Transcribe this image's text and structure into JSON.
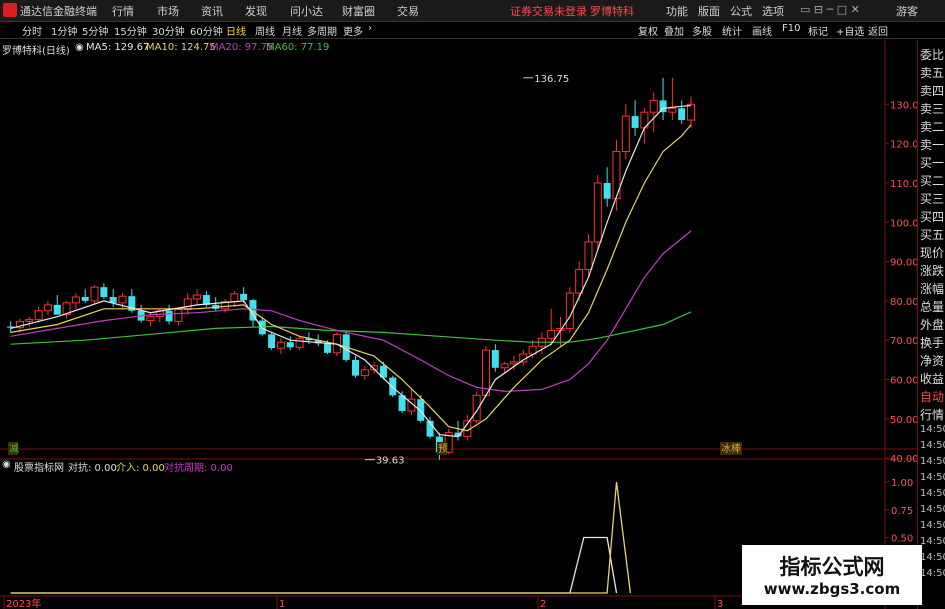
{
  "app": {
    "title": "通达信金融终端",
    "menu": [
      "行情",
      "市场",
      "资讯",
      "发现",
      "问小达",
      "财富圈",
      "交易"
    ],
    "notice": "证券交易未登录",
    "stock_name": "罗博特科",
    "right_menu": [
      "功能",
      "版面",
      "公式",
      "选项"
    ],
    "guest": "游客"
  },
  "periods": [
    "分时",
    "1分钟",
    "5分钟",
    "15分钟",
    "30分钟",
    "60分钟",
    "日线",
    "周线",
    "月线",
    "多周期",
    "更多"
  ],
  "active_period": "日线",
  "tools": [
    "复权",
    "叠加",
    "多股",
    "统计",
    "画线",
    "F10",
    "标记",
    "+自选",
    "返回"
  ],
  "header": {
    "stock": "罗博特科",
    "period": "(日线)",
    "ma": [
      {
        "label": "MA5: 129.67",
        "color": "#e8e8e8"
      },
      {
        "label": "MA10: 124.75",
        "color": "#e6d468"
      },
      {
        "label": "MA20: 97.75",
        "color": "#c040c0"
      },
      {
        "label": "MA60: 77.19",
        "color": "#40c040"
      }
    ]
  },
  "right_panel": [
    "委比",
    "卖五",
    "卖四",
    "卖三",
    "卖二",
    "卖一",
    "买一",
    "买二",
    "买三",
    "买四",
    "买五",
    "现价",
    "涨跌",
    "涨幅",
    "总量",
    "外盘",
    "换手",
    "净资",
    "收益",
    "自动",
    "行情",
    "14:50",
    "14:50",
    "14:50",
    "14:50",
    "14:50",
    "14:50",
    "14:50",
    "14:50",
    "14:50",
    "14:50"
  ],
  "indicator": {
    "name": "股票指标网",
    "duikang": "对抗: 0.00",
    "jieru": "介入: 0.00",
    "zhouqi": "对抗周期: 0.00",
    "yticks": [
      "1.00",
      "0.75",
      "0.50",
      "0.25"
    ]
  },
  "markers": {
    "left": "减",
    "mid": "预",
    "right": "冰棒"
  },
  "x_labels": [
    "2023年",
    "1",
    "2",
    "3"
  ],
  "watermark": {
    "line1": "指标公式网",
    "line2": "www.zbgs3.com"
  },
  "colors": {
    "up": "#ff3030",
    "down": "#40e0f0",
    "ma5": "#e8e8e8",
    "ma10": "#e6d468",
    "ma20": "#c040c0",
    "ma60": "#40c040",
    "axis": "#7a1010",
    "ind1": "#e8e8e8",
    "ind2": "#e6d468"
  },
  "chart_data": {
    "type": "candlestick",
    "ylim": [
      37,
      140
    ],
    "yticks": [
      40,
      50,
      60,
      70,
      80,
      90,
      100,
      110,
      120,
      130
    ],
    "annotations": [
      {
        "label": "136.75",
        "value": 136.75,
        "index": 55
      },
      {
        "label": "39.63",
        "value": 39.63,
        "index": 38
      }
    ],
    "ohlc": [
      [
        73.5,
        74.8,
        71.8,
        73.2
      ],
      [
        73.2,
        75.5,
        72,
        74.8
      ],
      [
        74.8,
        76,
        73.5,
        75.3
      ],
      [
        75.3,
        78.5,
        74.5,
        77.5
      ],
      [
        77.5,
        80,
        76.5,
        79
      ],
      [
        79,
        81.5,
        77,
        76.5
      ],
      [
        76.5,
        80,
        75.5,
        79.5
      ],
      [
        79.5,
        82,
        78,
        81
      ],
      [
        81,
        83,
        79.5,
        80
      ],
      [
        80,
        84,
        79,
        83.5
      ],
      [
        83.5,
        84.5,
        80.5,
        81
      ],
      [
        81,
        83,
        78.5,
        79.5
      ],
      [
        79.5,
        82,
        78,
        81.2
      ],
      [
        81.2,
        83,
        77,
        77.5
      ],
      [
        77.5,
        79,
        74.5,
        75
      ],
      [
        75,
        77,
        73.5,
        76
      ],
      [
        76,
        78,
        74.5,
        77.5
      ],
      [
        77.5,
        79,
        74,
        74.8
      ],
      [
        74.8,
        78,
        73.8,
        77.8
      ],
      [
        77.8,
        82,
        76.5,
        80.5
      ],
      [
        80.5,
        83,
        79,
        81.5
      ],
      [
        81.5,
        82.5,
        78.5,
        79
      ],
      [
        79,
        81,
        77.5,
        78
      ],
      [
        78,
        80.5,
        77,
        79.8
      ],
      [
        79.8,
        82.5,
        78.5,
        81.8
      ],
      [
        81.8,
        83.5,
        79.5,
        80.2
      ],
      [
        80.2,
        80.5,
        73.5,
        75
      ],
      [
        75,
        76,
        71,
        71.5
      ],
      [
        71.5,
        72,
        67.5,
        68
      ],
      [
        68,
        70.5,
        66.5,
        69.5
      ],
      [
        69.5,
        71,
        67.5,
        68.2
      ],
      [
        68.2,
        71,
        67.5,
        70.5
      ],
      [
        70.5,
        72,
        69,
        70
      ],
      [
        70,
        71.5,
        68.5,
        69.2
      ],
      [
        69.2,
        70,
        66.5,
        66.8
      ],
      [
        66.8,
        72,
        66,
        71.5
      ],
      [
        71.5,
        72.5,
        64.5,
        65
      ],
      [
        65,
        66,
        60.5,
        61
      ],
      [
        61,
        63.5,
        60,
        62.5
      ],
      [
        62.5,
        64.5,
        61.5,
        63.5
      ],
      [
        63.5,
        64.5,
        60,
        60.5
      ],
      [
        60.5,
        61,
        55.5,
        56
      ],
      [
        56,
        57,
        51.5,
        52
      ],
      [
        52,
        57.5,
        51,
        55
      ],
      [
        55,
        56,
        49,
        49.5
      ],
      [
        49.5,
        50.5,
        45,
        45.5
      ],
      [
        45.5,
        46.5,
        39.6,
        41.5
      ],
      [
        41.5,
        47.5,
        41,
        46.5
      ],
      [
        46.5,
        49.5,
        44.5,
        45.5
      ],
      [
        45.5,
        51,
        44.5,
        49.5
      ],
      [
        49.5,
        57,
        49,
        56
      ],
      [
        56,
        68.5,
        55.5,
        67.5
      ],
      [
        67.5,
        69,
        62,
        63
      ],
      [
        63,
        64.5,
        61.5,
        64
      ],
      [
        64,
        66,
        62.5,
        64.5
      ],
      [
        64.5,
        67.5,
        63.5,
        66.5
      ],
      [
        66.5,
        70,
        65.5,
        68.5
      ],
      [
        68.5,
        72,
        66.5,
        70.5
      ],
      [
        70.5,
        78,
        69,
        72.5
      ],
      [
        72.5,
        76,
        68.5,
        73
      ],
      [
        73,
        83.5,
        72,
        82
      ],
      [
        82,
        90,
        80,
        88
      ],
      [
        88,
        97,
        86,
        95
      ],
      [
        95,
        112,
        93,
        110
      ],
      [
        110,
        114,
        104,
        106
      ],
      [
        106,
        121,
        103,
        118
      ],
      [
        118,
        130,
        116,
        127
      ],
      [
        127,
        131,
        122,
        124
      ],
      [
        124,
        129,
        120,
        128
      ],
      [
        128,
        133,
        123,
        131
      ],
      [
        131,
        136.75,
        126,
        128
      ],
      [
        128,
        136.75,
        126,
        129
      ],
      [
        129,
        131,
        125,
        126
      ],
      [
        126,
        132,
        124,
        130
      ]
    ],
    "ma5_pts": [
      [
        0,
        73
      ],
      [
        5,
        76
      ],
      [
        10,
        80
      ],
      [
        15,
        77
      ],
      [
        20,
        79
      ],
      [
        25,
        80
      ],
      [
        27,
        73
      ],
      [
        30,
        70
      ],
      [
        35,
        69
      ],
      [
        38,
        65
      ],
      [
        41,
        58
      ],
      [
        44,
        52
      ],
      [
        46,
        46
      ],
      [
        48,
        45.5
      ],
      [
        50,
        52
      ],
      [
        52,
        60
      ],
      [
        55,
        65
      ],
      [
        58,
        69
      ],
      [
        60,
        76
      ],
      [
        62,
        86
      ],
      [
        64,
        100
      ],
      [
        66,
        113
      ],
      [
        68,
        124
      ],
      [
        70,
        129
      ],
      [
        72,
        129.5
      ],
      [
        73,
        129.7
      ]
    ],
    "ma10_pts": [
      [
        0,
        72
      ],
      [
        5,
        74
      ],
      [
        10,
        78
      ],
      [
        15,
        78
      ],
      [
        20,
        78
      ],
      [
        25,
        79
      ],
      [
        28,
        74
      ],
      [
        31,
        71
      ],
      [
        35,
        69
      ],
      [
        39,
        66
      ],
      [
        42,
        60
      ],
      [
        45,
        53
      ],
      [
        47,
        48
      ],
      [
        49,
        47
      ],
      [
        51,
        50
      ],
      [
        54,
        58
      ],
      [
        57,
        65
      ],
      [
        60,
        70
      ],
      [
        62,
        77
      ],
      [
        64,
        88
      ],
      [
        66,
        100
      ],
      [
        68,
        110
      ],
      [
        70,
        118
      ],
      [
        72,
        122
      ],
      [
        73,
        124.8
      ]
    ],
    "ma20_pts": [
      [
        0,
        71
      ],
      [
        5,
        73
      ],
      [
        10,
        75
      ],
      [
        15,
        76.5
      ],
      [
        20,
        77
      ],
      [
        25,
        78
      ],
      [
        28,
        77.5
      ],
      [
        31,
        75
      ],
      [
        35,
        72.5
      ],
      [
        40,
        70
      ],
      [
        44,
        65
      ],
      [
        47,
        61
      ],
      [
        50,
        58
      ],
      [
        53,
        57
      ],
      [
        57,
        57.5
      ],
      [
        60,
        60
      ],
      [
        62,
        64
      ],
      [
        64,
        70
      ],
      [
        66,
        78
      ],
      [
        68,
        86
      ],
      [
        70,
        92
      ],
      [
        73,
        97.8
      ]
    ],
    "ma60_pts": [
      [
        0,
        69
      ],
      [
        8,
        70
      ],
      [
        15,
        71.5
      ],
      [
        22,
        73
      ],
      [
        28,
        73.5
      ],
      [
        34,
        72.5
      ],
      [
        40,
        72
      ],
      [
        46,
        71
      ],
      [
        52,
        70
      ],
      [
        56,
        69.5
      ],
      [
        60,
        69.5
      ],
      [
        63,
        70.5
      ],
      [
        66,
        72
      ],
      [
        70,
        74
      ],
      [
        73,
        77.2
      ]
    ],
    "ind_series": [
      {
        "name": "对抗",
        "color": "#e8e8e8",
        "values": [
          [
            0,
            0
          ],
          [
            60,
            0
          ],
          [
            61.5,
            0.5
          ],
          [
            64,
            0.5
          ],
          [
            65,
            0
          ]
        ]
      },
      {
        "name": "介入",
        "color": "#e6d468",
        "values": [
          [
            0,
            0
          ],
          [
            64,
            0
          ],
          [
            65,
            1.0
          ],
          [
            66.5,
            0
          ]
        ]
      }
    ]
  }
}
